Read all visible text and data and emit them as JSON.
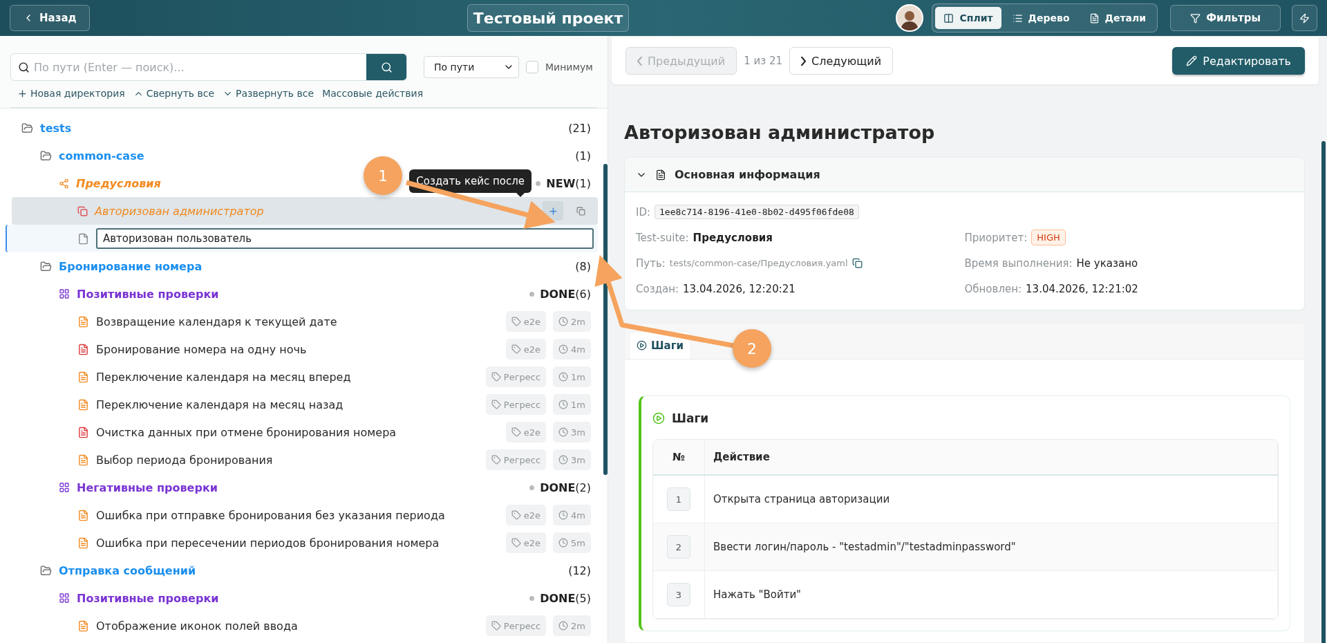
{
  "header": {
    "back": "Назад",
    "title": "Тестовый проект",
    "views": [
      {
        "label": "Сплит",
        "selected": true
      },
      {
        "label": "Дерево",
        "selected": false
      },
      {
        "label": "Детали",
        "selected": false
      }
    ],
    "filters": "Фильтры"
  },
  "sidebar": {
    "search": {
      "placeholder": "По пути (Enter — поиск)..."
    },
    "mode": "По пути",
    "minimum": {
      "label": "Минимум",
      "checked": false
    },
    "actions": [
      "Новая директория",
      "Свернуть все",
      "Развернуть все",
      "Массовые действия"
    ],
    "tree": [
      {
        "kind": "folder",
        "name": "tests",
        "count": "(21)",
        "children": [
          {
            "kind": "folder",
            "name": "common-case",
            "count": "(1)",
            "children": [
              {
                "kind": "preconditions",
                "name": "Предусловия",
                "status": "NEW",
                "count": "(1)",
                "children": [
                  {
                    "kind": "precondition",
                    "name": "Авторизован администратор",
                    "selected": true,
                    "tooltip": "Создать кейс после"
                  },
                  {
                    "kind": "new",
                    "value": "Авторизован пользователь"
                  }
                ]
              }
            ]
          },
          {
            "kind": "folder",
            "name": "Бронирование номера",
            "count": "(8)",
            "children": [
              {
                "kind": "suite",
                "name": "Позитивные проверки",
                "status": "DONE",
                "count": "(6)",
                "children": [
                  {
                    "kind": "case",
                    "name": "Возвращение календаря к текущей дате",
                    "color": "#f28a1f",
                    "tag": "e2e",
                    "duration": "2m",
                    "selected": false
                  },
                  {
                    "kind": "case",
                    "name": "Бронирование номера на одну ночь",
                    "color": "#e03a3e",
                    "tag": "e2e",
                    "duration": "4m",
                    "selected": false
                  },
                  {
                    "kind": "case",
                    "name": "Переключение календаря на месяц вперед",
                    "color": "#f28a1f",
                    "tag": "Регресс",
                    "duration": "1m",
                    "selected": false
                  },
                  {
                    "kind": "case",
                    "name": "Переключение календаря на месяц назад",
                    "color": "#f28a1f",
                    "tag": "Регресс",
                    "duration": "1m",
                    "selected": false
                  },
                  {
                    "kind": "case",
                    "name": "Очистка данных при отмене бронирования номера",
                    "color": "#e03a3e",
                    "tag": "e2e",
                    "duration": "3m",
                    "selected": false
                  },
                  {
                    "kind": "case",
                    "name": "Выбор периода бронирования",
                    "color": "#f28a1f",
                    "tag": "Регресс",
                    "duration": "3m",
                    "selected": false
                  }
                ]
              },
              {
                "kind": "suite",
                "name": "Негативные проверки",
                "status": "DONE",
                "count": "(2)",
                "children": [
                  {
                    "kind": "case",
                    "name": "Ошибка при отправке бронирования без указания периода",
                    "color": "#f28a1f",
                    "tag": "e2e",
                    "duration": "4m",
                    "selected": false
                  },
                  {
                    "kind": "case",
                    "name": "Ошибка при пересечении периодов бронирования номера",
                    "color": "#f28a1f",
                    "tag": "e2e",
                    "duration": "5m",
                    "selected": false
                  }
                ]
              }
            ]
          },
          {
            "kind": "folder",
            "name": "Отправка сообщений",
            "count": "(12)",
            "children": [
              {
                "kind": "suite",
                "name": "Позитивные проверки",
                "status": "DONE",
                "count": "(5)",
                "children": [
                  {
                    "kind": "case",
                    "name": "Отображение иконок полей ввода",
                    "color": "#f28a1f",
                    "tag": "Регресс",
                    "duration": "2m",
                    "selected": false
                  }
                ]
              }
            ]
          }
        ]
      }
    ]
  },
  "nav": {
    "previous": {
      "label": "Предыдущий",
      "disabled": true
    },
    "position": "1 из 21",
    "next": {
      "label": "Следующий",
      "disabled": false
    },
    "edit": "Редактировать"
  },
  "detail": {
    "title": "Авторизован администратор",
    "info": {
      "title": "Основная информация",
      "expanded": true,
      "left": [
        {
          "kind": "code",
          "label": "ID:",
          "value": "1ee8c714-8196-41e0-8b02-d495f06fde08"
        },
        {
          "kind": "bold",
          "label": "Test-suite:",
          "value": "Предусловия"
        },
        {
          "kind": "path",
          "label": "Путь:",
          "value": "tests/common-case/Предусловия.yaml"
        },
        {
          "kind": "text",
          "label": "Создан:",
          "value": "13.04.2026, 12:20:21"
        }
      ],
      "right": [
        {
          "kind": "badge",
          "label": "Приоритет:",
          "value": "HIGH"
        },
        {
          "kind": "text",
          "label": "Время выполнения:",
          "value": "Не указано"
        },
        {
          "kind": "text",
          "label": "Обновлен:",
          "value": "13.04.2026, 12:21:02"
        }
      ]
    },
    "tabs": [
      {
        "label": "Шаги",
        "selected": true
      }
    ],
    "steps": {
      "title": "Шаги",
      "columns": [
        "№",
        "Действие"
      ],
      "rows": [
        {
          "number": "1",
          "action": "Открыта страница авторизации"
        },
        {
          "number": "2",
          "action": "Ввести логин/пароль - \"testadmin\"/\"testadminpassword\""
        },
        {
          "number": "3",
          "action": "Нажать \"Войти\""
        }
      ]
    }
  },
  "annotations": [
    {
      "label": "1"
    },
    {
      "label": "2"
    }
  ]
}
